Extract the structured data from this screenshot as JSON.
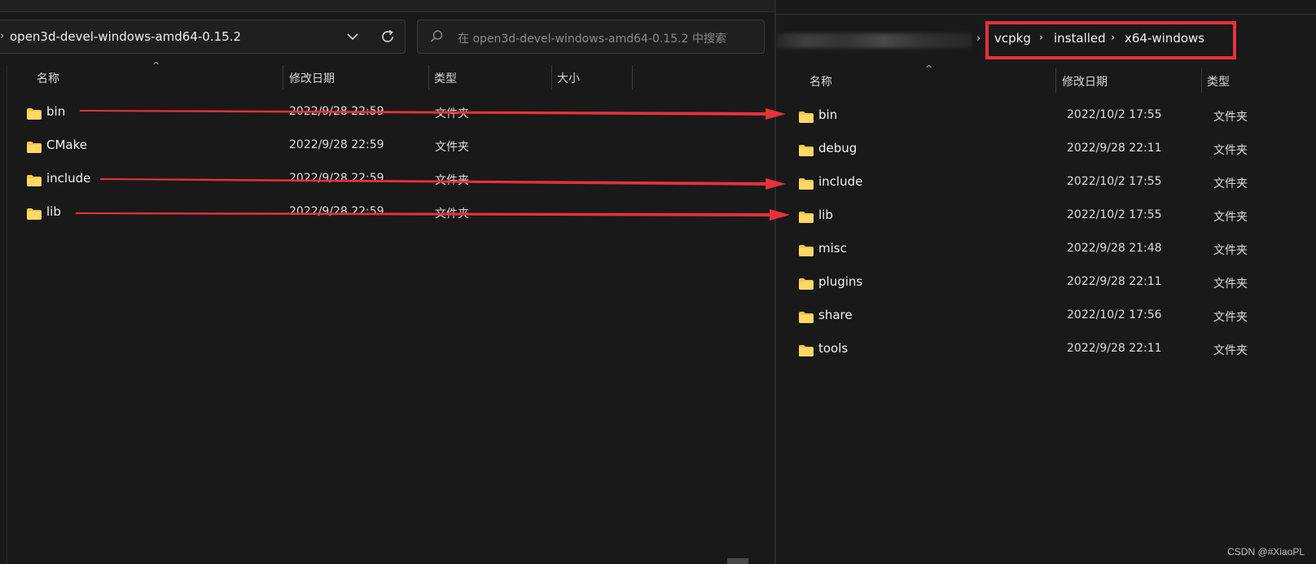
{
  "left_window": {
    "address_path": "open3d-devel-windows-amd64-0.15.2",
    "search_placeholder": "在 open3d-devel-windows-amd64-0.15.2 中搜索",
    "columns": {
      "name": "名称",
      "modified": "修改日期",
      "type": "类型",
      "size": "大小"
    },
    "rows": [
      {
        "name": "bin",
        "modified": "2022/9/28 22:59",
        "type": "文件夹"
      },
      {
        "name": "CMake",
        "modified": "2022/9/28 22:59",
        "type": "文件夹"
      },
      {
        "name": "include",
        "modified": "2022/9/28 22:59",
        "type": "文件夹"
      },
      {
        "name": "lib",
        "modified": "2022/9/28 22:59",
        "type": "文件夹"
      }
    ]
  },
  "right_window": {
    "breadcrumb": [
      "vcpkg",
      "installed",
      "x64-windows"
    ],
    "columns": {
      "name": "名称",
      "modified": "修改日期",
      "type": "类型"
    },
    "rows": [
      {
        "name": "bin",
        "modified": "2022/10/2 17:55",
        "type": "文件夹"
      },
      {
        "name": "debug",
        "modified": "2022/9/28 22:11",
        "type": "文件夹"
      },
      {
        "name": "include",
        "modified": "2022/10/2 17:55",
        "type": "文件夹"
      },
      {
        "name": "lib",
        "modified": "2022/10/2 17:55",
        "type": "文件夹"
      },
      {
        "name": "misc",
        "modified": "2022/9/28 21:48",
        "type": "文件夹"
      },
      {
        "name": "plugins",
        "modified": "2022/9/28 22:11",
        "type": "文件夹"
      },
      {
        "name": "share",
        "modified": "2022/10/2 17:56",
        "type": "文件夹"
      },
      {
        "name": "tools",
        "modified": "2022/9/28 22:11",
        "type": "文件夹"
      }
    ]
  },
  "annotation": {
    "arrow_color": "#e8313a",
    "highlight_color": "#e8313a"
  },
  "colors": {
    "background": "#191919",
    "folder": "#f4c84a",
    "text": "#f2f2f2"
  },
  "watermark": "CSDN @#XiaoPL"
}
